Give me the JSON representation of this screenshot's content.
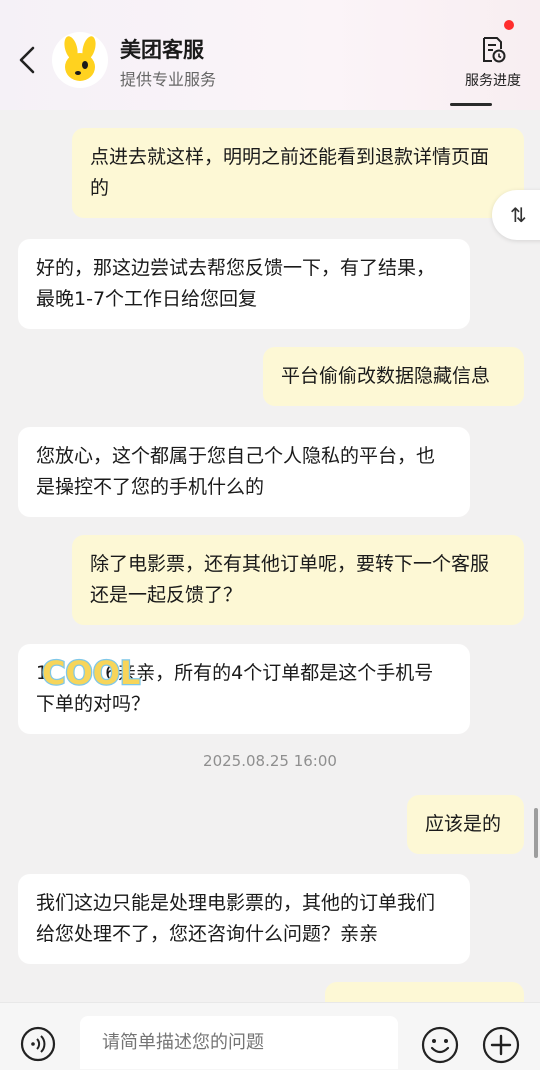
{
  "header": {
    "title": "美团客服",
    "subtitle": "提供专业服务",
    "progress_label": "服务进度"
  },
  "side_button": {
    "label": "⇅"
  },
  "messages": [
    {
      "from": "me",
      "text": "点进去就这样，明明之前还能看到退款详情页面的"
    },
    {
      "from": "them",
      "text": "好的，那这边尝试去帮您反馈一下，有了结果，最晚1-7个工作日给您回复"
    },
    {
      "from": "me",
      "text": "平台偷偷改数据隐藏信息"
    },
    {
      "from": "them",
      "text": "您放心，这个都属于您自己个人隐私的平台，也是操控不了您的手机什么的"
    },
    {
      "from": "me",
      "text": "除了电影票，还有其他订单呢，要转下一个客服还是一起反馈了？"
    },
    {
      "from": "them",
      "text": "1　　　6亲亲，所有的4个订单都是这个手机号下单的对吗？"
    },
    {
      "from": "me",
      "text": "应该是的"
    },
    {
      "from": "them",
      "text": "我们这边只能是处理电影票的，其他的订单我们给您处理不了，您还咨询什么问题？亲亲"
    }
  ],
  "timestamp": "2025.08.25 16:00",
  "sticker_text": "COOL",
  "input": {
    "placeholder": "请简单描述您的问题"
  },
  "colors": {
    "my_bubble": "#fdf8d5",
    "their_bubble": "#ffffff",
    "background": "#f2f1f1",
    "notification_dot": "#ff2d2d"
  },
  "icons": {
    "back": "chevron-left-icon",
    "progress": "document-clock-icon",
    "voice": "voice-icon",
    "emoji": "smile-icon",
    "plus": "plus-icon"
  }
}
